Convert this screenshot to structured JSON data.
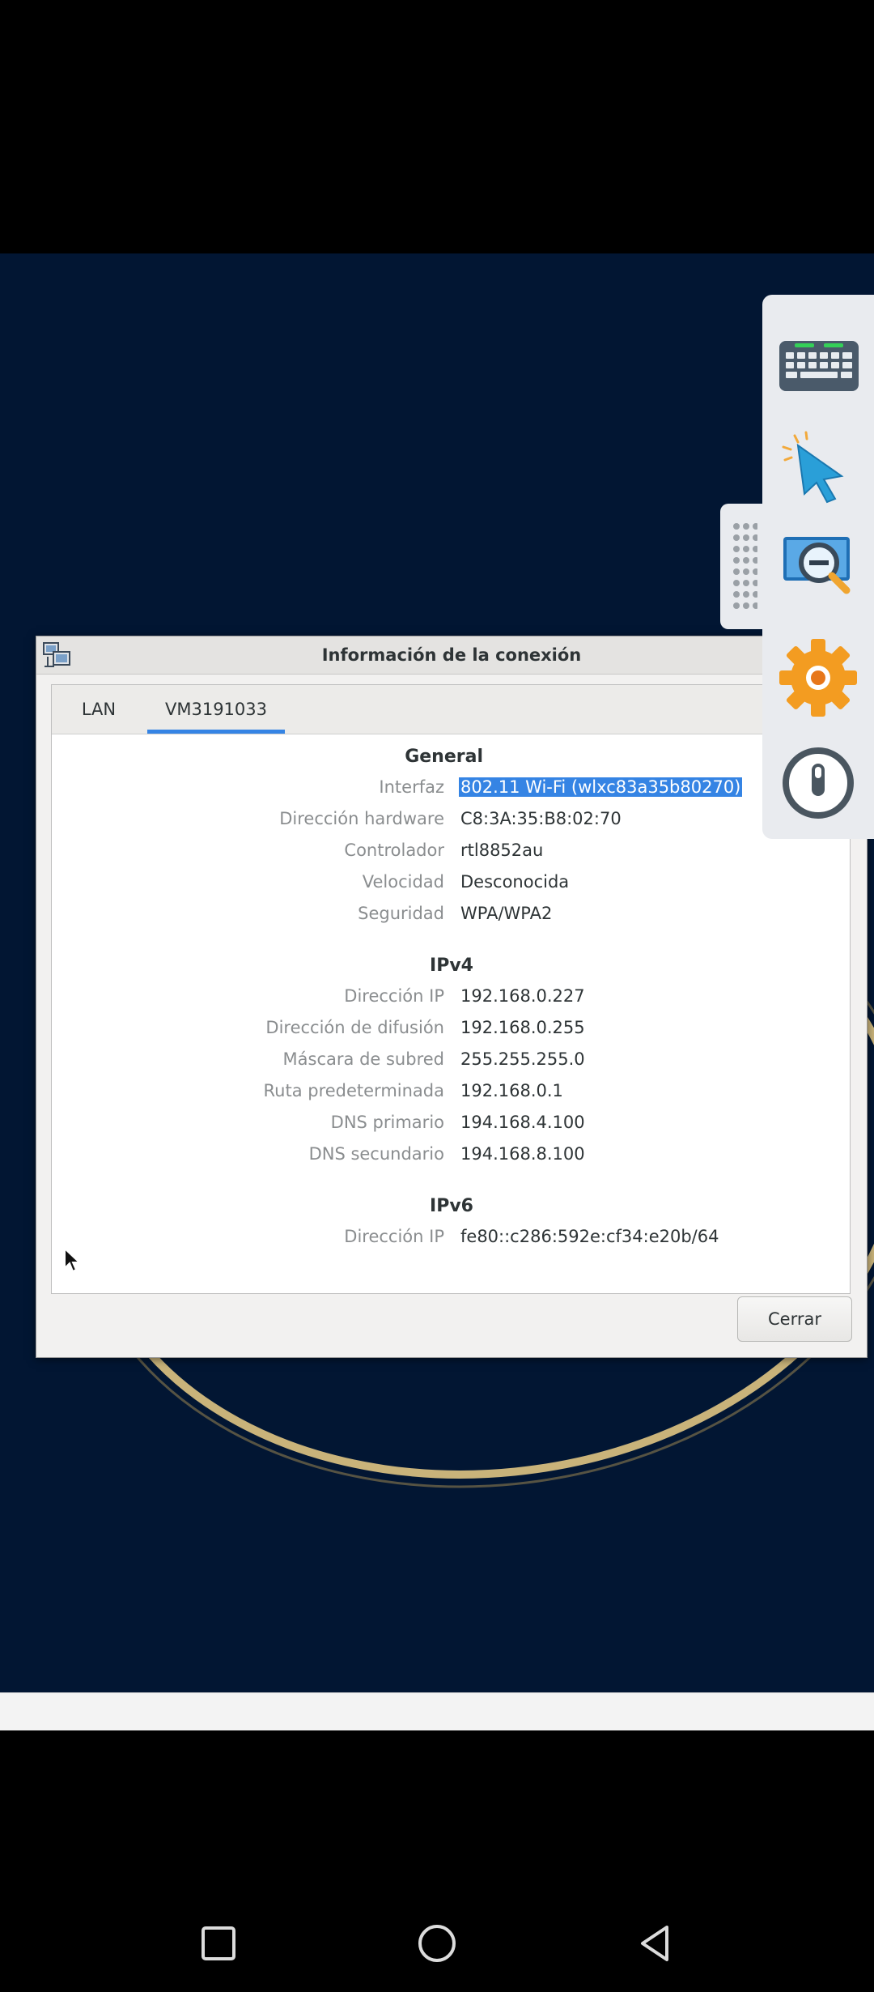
{
  "dialog": {
    "title": "Información de la conexión",
    "tabs": [
      {
        "label": "LAN",
        "active": false
      },
      {
        "label": "VM3191033",
        "active": true
      }
    ],
    "sections": {
      "general": {
        "title": "General",
        "rows": [
          {
            "label": "Interfaz",
            "value": "802.11 Wi-Fi (wlxc83a35b80270)",
            "selected": true
          },
          {
            "label": "Dirección hardware",
            "value": "C8:3A:35:B8:02:70"
          },
          {
            "label": "Controlador",
            "value": "rtl8852au"
          },
          {
            "label": "Velocidad",
            "value": "Desconocida"
          },
          {
            "label": "Seguridad",
            "value": "WPA/WPA2"
          }
        ]
      },
      "ipv4": {
        "title": "IPv4",
        "rows": [
          {
            "label": "Dirección IP",
            "value": "192.168.0.227"
          },
          {
            "label": "Dirección de difusión",
            "value": "192.168.0.255"
          },
          {
            "label": "Máscara de subred",
            "value": "255.255.255.0"
          },
          {
            "label": "Ruta predeterminada",
            "value": "192.168.0.1"
          },
          {
            "label": "DNS primario",
            "value": "194.168.4.100"
          },
          {
            "label": "DNS secundario",
            "value": "194.168.8.100"
          }
        ]
      },
      "ipv6": {
        "title": "IPv6",
        "rows": [
          {
            "label": "Dirección IP",
            "value": "fe80::c286:592e:cf34:e20b/64"
          }
        ]
      }
    },
    "close_label": "Cerrar"
  },
  "toolbar": {
    "items": [
      {
        "icon": "keyboard-icon"
      },
      {
        "icon": "pointer-icon"
      },
      {
        "icon": "zoom-out-icon"
      },
      {
        "icon": "settings-gear-icon"
      },
      {
        "icon": "power-icon"
      }
    ]
  },
  "navbar": {
    "buttons": [
      "recent-apps-button",
      "home-button",
      "back-button"
    ]
  },
  "colors": {
    "desktop_bg": "#021633",
    "selection": "#3584e4",
    "tab_accent": "#3584e4",
    "gold_ring": "#c9b37a"
  }
}
